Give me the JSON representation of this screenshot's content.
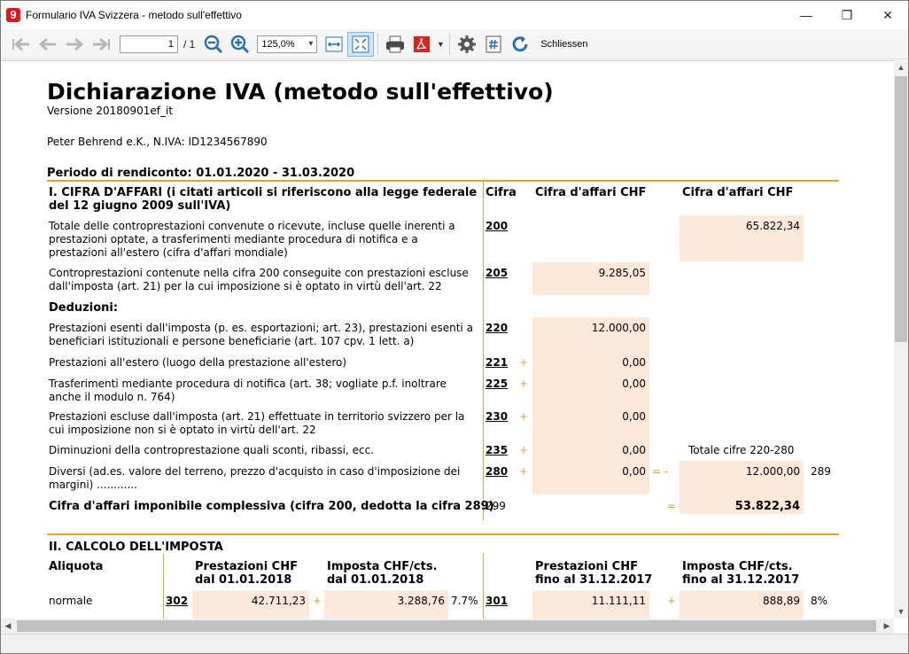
{
  "window": {
    "title": "Formulario IVA Svizzera - metodo sull'effettivo",
    "app_icon_glyph": "9",
    "minimize": "—",
    "maximize": "❐",
    "close": "✕"
  },
  "toolbar": {
    "page_value": "1",
    "page_total": "/ 1",
    "zoom": "125,0%",
    "close_label": "Schliessen"
  },
  "doc": {
    "title": "Dichiarazione IVA (metodo sull'effettivo)",
    "version": "Versione 20180901ef_it",
    "company": "Peter Behrend e.K., N.IVA: ID1234567890",
    "period": "Periodo di rendiconto: 01.01.2020 - 31.03.2020",
    "section1": {
      "heading": "I. CIFRA D'AFFARI (i citati articoli si riferiscono alla legge federale del 12 giugno 2009 sull'IVA)",
      "col_cifra": "Cifra",
      "col_chf1": "Cifra d'affari CHF",
      "col_chf2": "Cifra d'affari CHF",
      "rows": {
        "r200": {
          "text": "Totale delle controprestazioni convenute o ricevute, incluse quelle inerenti a prestazioni optate, a trasferimenti mediante procedura di notifica e a prestazioni all'estero (cifra d'affari mondiale)",
          "code": "200",
          "value": "65.822,34"
        },
        "r205": {
          "text": "Controprestazioni contenute nella cifra 200 conseguite con prestazioni escluse dall'imposta (art. 21) per la cui imposizione si è optato in virtù dell'art. 22",
          "code": "205",
          "value": "9.285,05"
        },
        "deductions": "Deduzioni:",
        "r220": {
          "text": "Prestazioni esenti dall'imposta (p. es. esportazioni; art. 23), prestazioni esenti a beneficiari istituzionali e persone beneficiarie (art. 107 cpv. 1 lett. a)",
          "code": "220",
          "value": "12.000,00"
        },
        "r221": {
          "text": "Prestazioni all'estero (luogo della prestazione all'estero)",
          "code": "221",
          "plus": "+",
          "value": "0,00"
        },
        "r225": {
          "text": "Trasferimenti mediante procedura di notifica (art. 38; vogliate p.f. inoltrare anche il modulo n. 764)",
          "code": "225",
          "plus": "+",
          "value": "0,00"
        },
        "r230": {
          "text": "Prestazioni escluse dall'imposta (art. 21) effettuate in territorio svizzero per la cui imposizione non si è optato in virtù dell'art. 22",
          "code": "230",
          "plus": "+",
          "value": "0,00"
        },
        "r235": {
          "text": "Diminuzioni della controprestazione quali sconti, ribassi, ecc.",
          "code": "235",
          "plus": "+",
          "value": "0,00",
          "total_label": "Totale cifre 220-280"
        },
        "r280": {
          "text": "Diversi (ad.es. valore del terreno, prezzo d'acquisto in caso d'imposizione dei margini) ............",
          "code": "280",
          "plus": "+",
          "value": "0,00",
          "eq": "= -",
          "total": "12.000,00",
          "total_code": "289"
        },
        "r299": {
          "text": "Cifra d'affari imponibile complessiva (cifra 200, dedotta la cifra 289)",
          "code": "299",
          "eq": "=",
          "value": "53.822,34"
        }
      }
    },
    "section2": {
      "heading": "II. CALCOLO DELL'IMPOSTA",
      "col_aliquota": "Aliquota",
      "col_prest1": "Prestazioni CHF dal 01.01.2018",
      "col_imp1": "Imposta CHF/cts. dal 01.01.2018",
      "col_prest2": "Prestazioni CHF fino al 31.12.2017",
      "col_imp2": "Imposta CHF/cts. fino al 31.12.2017",
      "normale": {
        "label": "normale",
        "code1": "302",
        "prest1": "42.711,23",
        "plus1": "+",
        "imp1": "3.288,76",
        "rate1": "7.7%",
        "code2": "301",
        "prest2": "11.111,11",
        "plus2": "+",
        "imp2": "888,89",
        "rate2": "8%"
      }
    }
  }
}
